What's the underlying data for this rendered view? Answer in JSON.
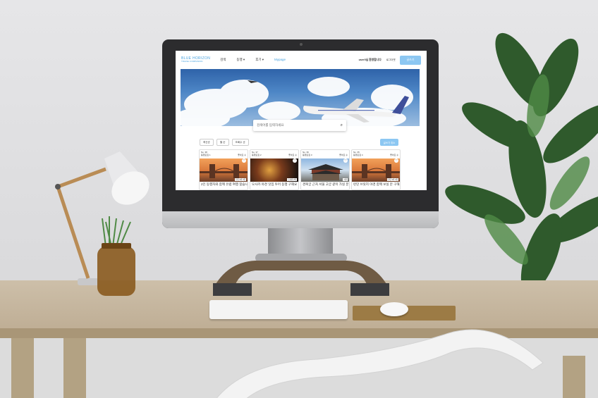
{
  "site": {
    "logo_main": "BLUE HORIZON",
    "logo_sub": "TRAVEL COMPANION"
  },
  "nav": {
    "items": [
      {
        "label": "검색"
      },
      {
        "label": "동행 ▾"
      },
      {
        "label": "후기 ▾"
      },
      {
        "label": "Mypage"
      }
    ],
    "user_label": "user0님 환영합니다",
    "logout_label": "로그아웃",
    "write_button": "글쓰기"
  },
  "search": {
    "placeholder": "검색어를 입력하세요",
    "icon": "search-icon"
  },
  "filters": [
    {
      "label": "최신순"
    },
    {
      "label": "별 순"
    },
    {
      "label": "조회수 순"
    }
  ],
  "sort_button": "글쓰기 취소",
  "cards": [
    {
      "date": "No. 38",
      "author": "동행모집 1",
      "likes": "좋아요 수",
      "tag": "런던 3박 4일",
      "title": "2인 동행자와 함께 유럽 여행 찾습니다",
      "theme": "london"
    },
    {
      "date": "No. 37",
      "author": "동행모집 2",
      "likes": "좋아요 수",
      "tag": "오사카 2박",
      "title": "오사카 야경 맛집 투어 동행 구해요",
      "theme": "night"
    },
    {
      "date": "No. 36",
      "author": "동행모집 3",
      "likes": "좋아요 수",
      "tag": "서울",
      "title": "경복궁 근처 서울 고궁 같이 가실 분",
      "theme": "palace"
    },
    {
      "date": "No. 35",
      "author": "동행모집 4",
      "likes": "좋아요 수",
      "tag": "런던 3박 4일",
      "title": "런던 브릿지 야경 함께 보실 분 구해요",
      "theme": "london"
    }
  ],
  "colors": {
    "accent": "#4aa3df",
    "button": "#8cc7f2"
  }
}
